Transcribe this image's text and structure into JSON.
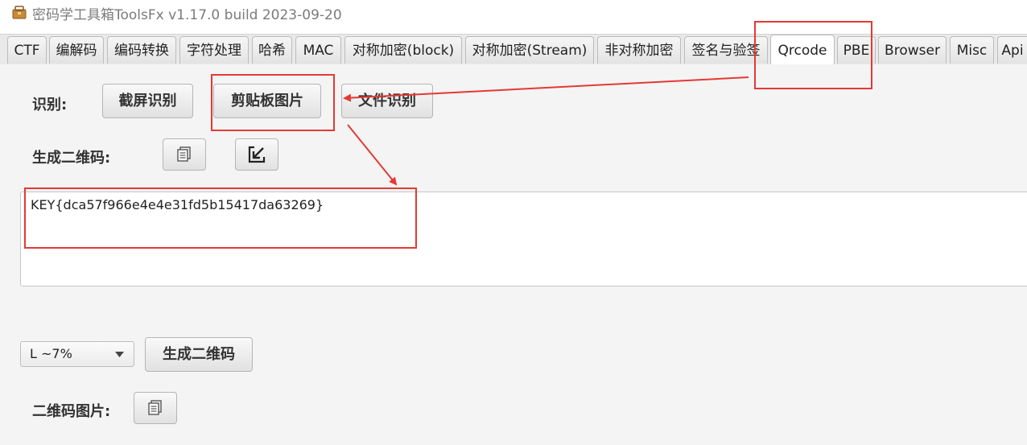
{
  "window": {
    "title": "密码学工具箱ToolsFx v1.17.0 build 2023-09-20",
    "icon": "toolbox-icon"
  },
  "tabs": [
    {
      "label": "CTF",
      "active": false
    },
    {
      "label": "编解码",
      "active": false
    },
    {
      "label": "编码转换",
      "active": false
    },
    {
      "label": "字符处理",
      "active": false
    },
    {
      "label": "哈希",
      "active": false
    },
    {
      "label": "MAC",
      "active": false
    },
    {
      "label": "对称加密(block)",
      "active": false
    },
    {
      "label": "对称加密(Stream)",
      "active": false
    },
    {
      "label": "非对称加密",
      "active": false
    },
    {
      "label": "签名与验签",
      "active": false
    },
    {
      "label": "Qrcode",
      "active": true
    },
    {
      "label": "PBE",
      "active": false
    },
    {
      "label": "Browser",
      "active": false
    },
    {
      "label": "Misc",
      "active": false
    },
    {
      "label": "Api",
      "active": false
    }
  ],
  "recognize": {
    "label": "识别:",
    "screenshot_button": "截屏识别",
    "clipboard_button": "剪贴板图片",
    "file_button": "文件识别"
  },
  "generate": {
    "label": "生成二维码:",
    "copy_icon": "copy-icon",
    "import_icon": "import-arrow-icon"
  },
  "output_text": "KEY{dca57f966e4e4e31fd5b15417da63269}",
  "error_correction": {
    "selected": "L ~7%"
  },
  "generate_button": "生成二维码",
  "qr_image": {
    "label": "二维码图片:",
    "copy_icon": "copy-icon"
  },
  "colors": {
    "annotation": "#e53935",
    "tab_bar": "#e9e9e9",
    "content_bg": "#f4f4f4"
  }
}
